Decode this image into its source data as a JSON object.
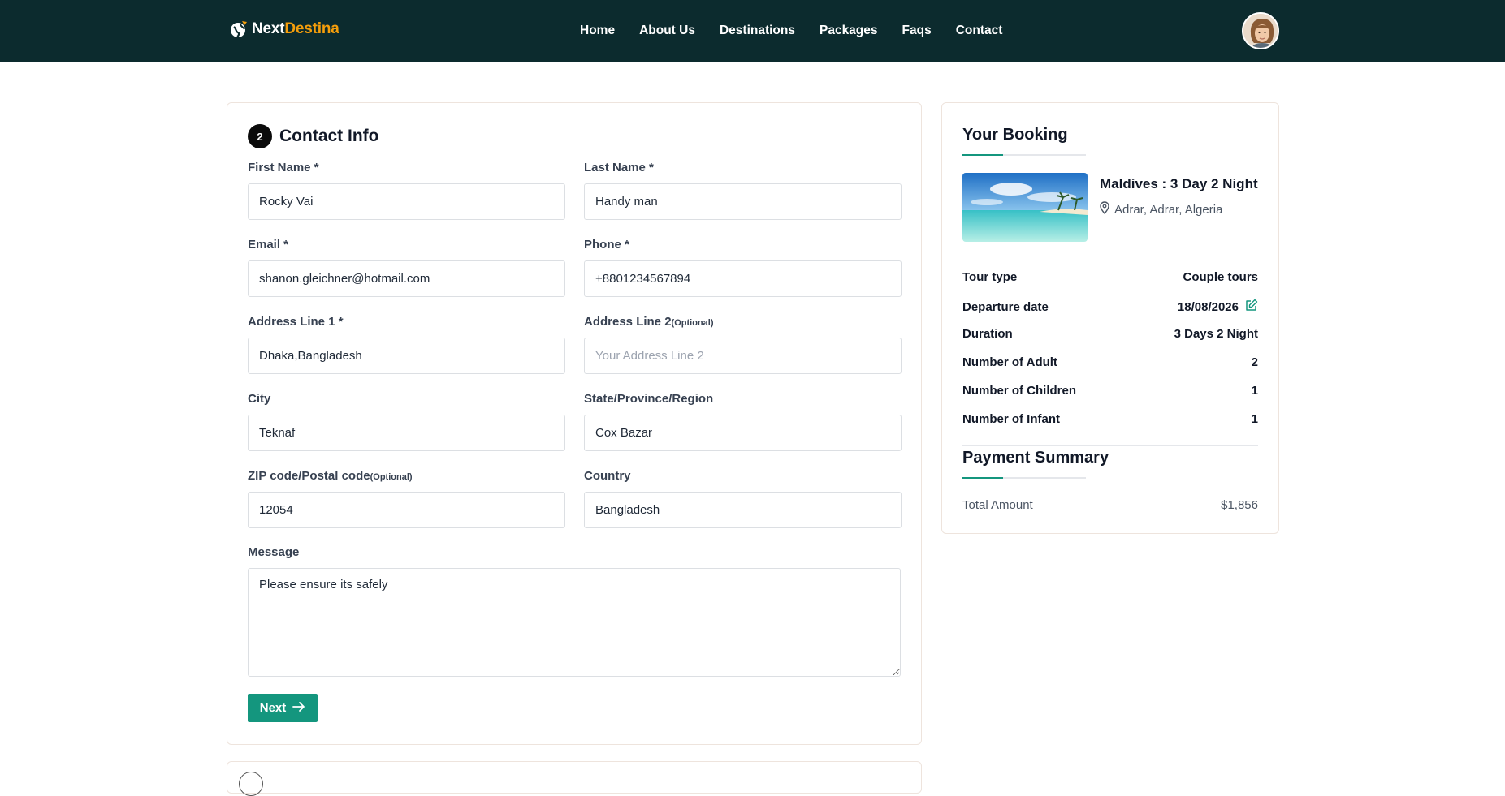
{
  "brand": {
    "name_part1": "Next",
    "name_part2": "Destina",
    "accent_color": "#f59e0b",
    "nav_bg": "#0c2b2e"
  },
  "nav": {
    "items": [
      "Home",
      "About Us",
      "Destinations",
      "Packages",
      "Faqs",
      "Contact"
    ]
  },
  "user": {
    "avatar_icon": "user-avatar"
  },
  "contact_form": {
    "step_number": "2",
    "title": "Contact Info",
    "fields": {
      "first_name": {
        "label": "First Name *",
        "value": "Rocky Vai"
      },
      "last_name": {
        "label": "Last Name *",
        "value": "Handy man"
      },
      "email": {
        "label": "Email *",
        "value": "shanon.gleichner@hotmail.com"
      },
      "phone": {
        "label": "Phone *",
        "value": "+8801234567894"
      },
      "address1": {
        "label": "Address Line 1 *",
        "value": "Dhaka,Bangladesh"
      },
      "address2": {
        "label": "Address Line 2",
        "optional": "(Optional)",
        "value": "",
        "placeholder": "Your Address Line 2"
      },
      "city": {
        "label": "City",
        "value": "Teknaf"
      },
      "state": {
        "label": "State/Province/Region",
        "value": "Cox Bazar"
      },
      "zip": {
        "label": "ZIP code/Postal code",
        "optional": "(Optional)",
        "value": "12054"
      },
      "country": {
        "label": "Country",
        "value": "Bangladesh"
      },
      "message": {
        "label": "Message",
        "value": "Please ensure its safely"
      }
    },
    "next_label": "Next",
    "accent_color": "#14967e"
  },
  "booking": {
    "title": "Your Booking",
    "package_title": "Maldives : 3 Day 2 Night",
    "location": "Adrar, Adrar, Algeria",
    "rows": [
      {
        "label": "Tour type",
        "value": "Couple tours"
      },
      {
        "label": "Departure date",
        "value": "18/08/2026"
      },
      {
        "label": "Duration",
        "value": "3 Days 2 Night"
      },
      {
        "label": "Number of Adult",
        "value": "2"
      },
      {
        "label": "Number of Children",
        "value": "1"
      },
      {
        "label": "Number of Infant",
        "value": "1"
      }
    ],
    "payment_title": "Payment Summary",
    "total_label": "Total Amount",
    "total_value": "$1,856"
  }
}
